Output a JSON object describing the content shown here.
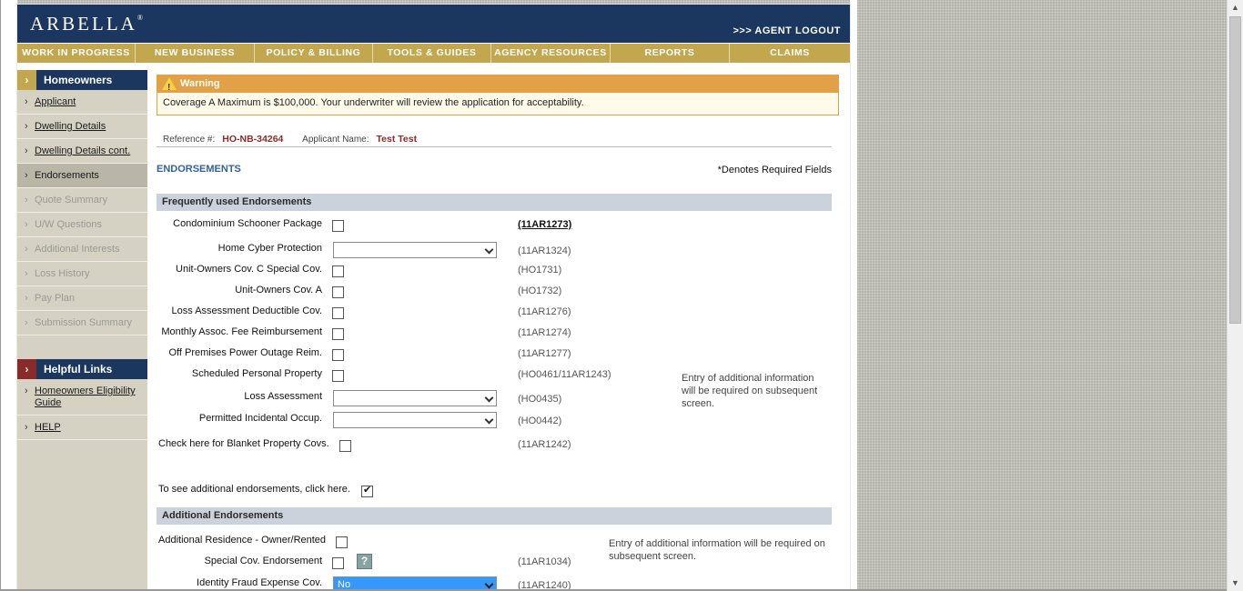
{
  "brand": {
    "logo": "ARBELLA",
    "logo_mark": "®",
    "logout_label": ">>> AGENT LOGOUT"
  },
  "nav": {
    "items": [
      {
        "label": "WORK IN PROGRESS"
      },
      {
        "label": "NEW BUSINESS"
      },
      {
        "label": "POLICY & BILLING"
      },
      {
        "label": "TOOLS & GUIDES"
      },
      {
        "label": "AGENCY RESOURCES"
      },
      {
        "label": "REPORTS"
      },
      {
        "label": "CLAIMS"
      }
    ]
  },
  "sidebar": {
    "section_title": "Homeowners",
    "items": [
      {
        "label": "Applicant",
        "state": "link"
      },
      {
        "label": "Dwelling Details",
        "state": "link"
      },
      {
        "label": "Dwelling Details cont.",
        "state": "link"
      },
      {
        "label": "Endorsements",
        "state": "active"
      },
      {
        "label": "Quote Summary",
        "state": "disabled"
      },
      {
        "label": "U/W Questions",
        "state": "disabled"
      },
      {
        "label": "Additional Interests",
        "state": "disabled"
      },
      {
        "label": "Loss History",
        "state": "disabled"
      },
      {
        "label": "Pay Plan",
        "state": "disabled"
      },
      {
        "label": "Submission Summary",
        "state": "disabled"
      }
    ],
    "helpful_title": "Helpful Links",
    "helpful_links": [
      {
        "label": "Homeowners Eligibility Guide"
      },
      {
        "label": "HELP"
      }
    ]
  },
  "warning": {
    "title": "Warning",
    "message": "Coverage A Maximum is $100,000. Your underwriter will review the application for acceptability."
  },
  "reference": {
    "ref_label": "Reference #:",
    "ref_value": "HO-NB-34264",
    "name_label": "Applicant Name:",
    "name_value": "Test Test"
  },
  "section": {
    "title": "ENDORSEMENTS",
    "required_note": "*Denotes Required Fields"
  },
  "frequent": {
    "title": "Frequently used Endorsements",
    "rows": [
      {
        "label": "Condominium Schooner Package",
        "control": "checkbox",
        "checked": false,
        "code": "(11AR1273)"
      },
      {
        "label": "Home Cyber Protection",
        "control": "select",
        "value": "",
        "code": "(11AR1324)"
      },
      {
        "label": "Unit-Owners Cov. C Special Cov.",
        "control": "checkbox",
        "checked": false,
        "code": "(HO1731)"
      },
      {
        "label": "Unit-Owners Cov. A",
        "control": "checkbox",
        "checked": false,
        "code": "(HO1732)"
      },
      {
        "label": "Loss Assessment Deductible Cov.",
        "control": "checkbox",
        "checked": false,
        "code": "(11AR1276)"
      },
      {
        "label": "Monthly Assoc. Fee Reimbursement",
        "control": "checkbox",
        "checked": false,
        "code": "(11AR1274)"
      },
      {
        "label": "Off Premises Power Outage Reim.",
        "control": "checkbox",
        "checked": false,
        "code": "(11AR1277)"
      },
      {
        "label": "Scheduled Personal Property",
        "control": "checkbox",
        "checked": false,
        "code": "(HO0461/11AR1243)"
      },
      {
        "label": "Loss Assessment",
        "control": "select",
        "value": "",
        "code": "(HO0435)"
      },
      {
        "label": "Permitted Incidental Occup.",
        "control": "select",
        "value": "",
        "code": "(HO0442)"
      },
      {
        "label": "Check here for Blanket Property Covs.",
        "control": "checkbox",
        "checked": false,
        "code": "(11AR1242)"
      }
    ],
    "note": "Entry of additional information will be required on subsequent screen."
  },
  "more": {
    "label": "To see additional endorsements, click here.",
    "checked": true
  },
  "additional": {
    "title": "Additional Endorsements",
    "rows": [
      {
        "label": "Additional Residence - Owner/Rented",
        "control": "checkbox",
        "checked": false,
        "code": ""
      },
      {
        "label": "Special Cov. Endorsement",
        "control": "checkbox",
        "checked": false,
        "code": "(11AR1034)",
        "help": "?"
      },
      {
        "label": "Identity Fraud Expense Cov.",
        "control": "select",
        "value": "No",
        "code": "(11AR1240)"
      }
    ],
    "note": "Entry of additional information will be required on subsequent screen."
  }
}
